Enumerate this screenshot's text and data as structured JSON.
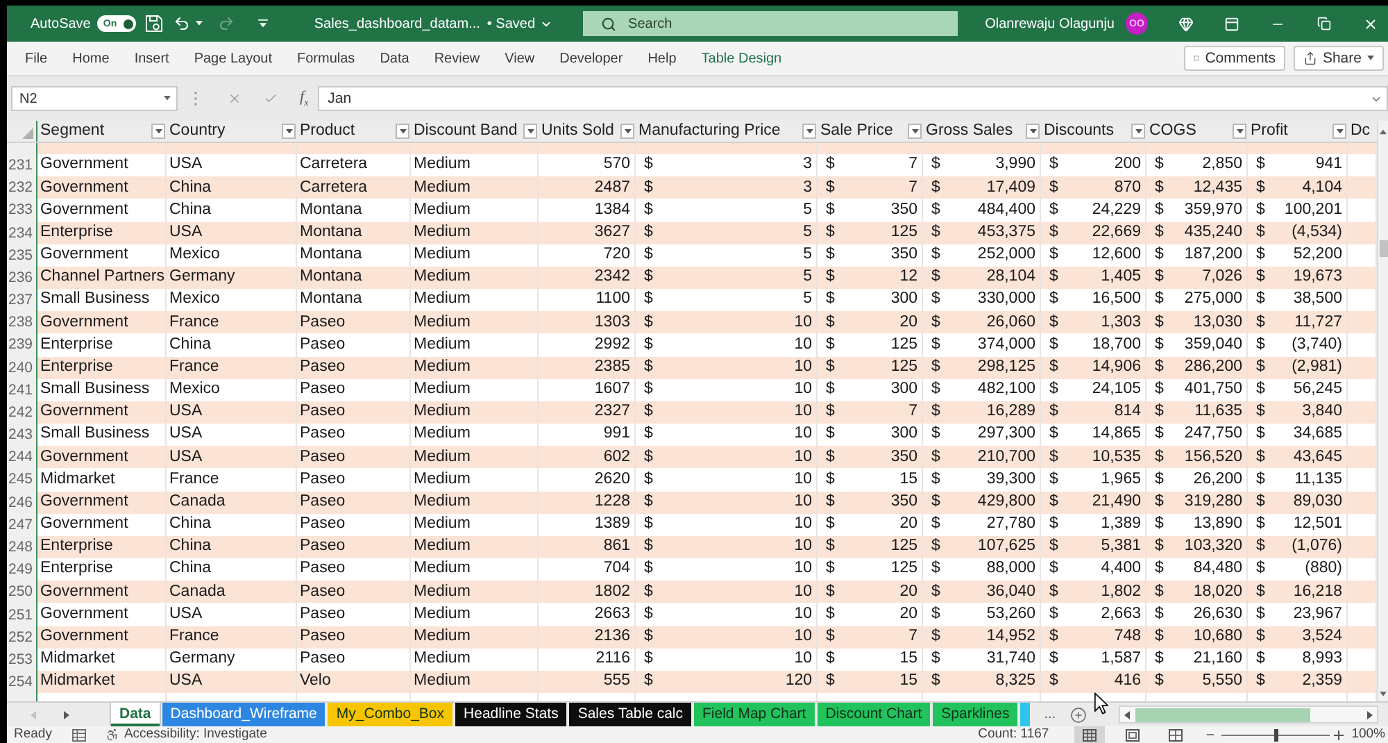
{
  "title_bar": {
    "autosave": {
      "label": "AutoSave",
      "on": true,
      "toggle_text": "On"
    },
    "redo": {
      "disabled": true
    },
    "document_title": "Sales_dashboard_datam...",
    "save_status": "• Saved",
    "search": {
      "placeholder": "Search"
    },
    "user": {
      "name": "Olanrewaju Olagunju",
      "initials": "OO"
    }
  },
  "ribbon": {
    "tabs": [
      {
        "label": "File",
        "kind": "standard",
        "selected": false
      },
      {
        "label": "Home",
        "kind": "standard",
        "selected": false
      },
      {
        "label": "Insert",
        "kind": "standard",
        "selected": false
      },
      {
        "label": "Page Layout",
        "kind": "standard",
        "selected": false
      },
      {
        "label": "Formulas",
        "kind": "standard",
        "selected": false
      },
      {
        "label": "Data",
        "kind": "standard",
        "selected": false
      },
      {
        "label": "Review",
        "kind": "standard",
        "selected": false
      },
      {
        "label": "View",
        "kind": "standard",
        "selected": false
      },
      {
        "label": "Developer",
        "kind": "standard",
        "selected": false
      },
      {
        "label": "Help",
        "kind": "standard",
        "selected": false
      },
      {
        "label": "Table Design",
        "kind": "contextual",
        "selected": false
      }
    ],
    "comments_button": "Comments",
    "share_button": "Share"
  },
  "formula_bar": {
    "name_box": "N2",
    "insert_function": "f$_{x}$",
    "formula": "Jan"
  },
  "table": {
    "columns": [
      {
        "label": "Segment",
        "filter_button": true
      },
      {
        "label": "Country",
        "filter_button": true
      },
      {
        "label": "Product",
        "filter_button": true
      },
      {
        "label": "Discount Band",
        "filter_button": true
      },
      {
        "label": "Units Sold",
        "filter_button": true
      },
      {
        "label": "Manufacturing Price",
        "filter_button": true
      },
      {
        "label": "Sale Price",
        "filter_button": true
      },
      {
        "label": "Gross Sales",
        "filter_button": true
      },
      {
        "label": "Discounts",
        "filter_button": true
      },
      {
        "label": "COGS",
        "filter_button": true
      },
      {
        "label": "Profit",
        "filter_button": true
      },
      {
        "label": "Dc",
        "filter_button": false
      }
    ],
    "rows": [
      {
        "row": "231",
        "cells": [
          "Government",
          "USA",
          "Carretera",
          "Medium",
          "570",
          [
            "$",
            "3"
          ],
          [
            "$",
            "7"
          ],
          [
            "$",
            "3,990"
          ],
          [
            "$",
            "200"
          ],
          [
            "$",
            "2,850"
          ],
          [
            "$",
            "941"
          ]
        ]
      },
      {
        "row": "232",
        "cells": [
          "Government",
          "China",
          "Carretera",
          "Medium",
          "2487",
          [
            "$",
            "3"
          ],
          [
            "$",
            "7"
          ],
          [
            "$",
            "17,409"
          ],
          [
            "$",
            "870"
          ],
          [
            "$",
            "12,435"
          ],
          [
            "$",
            "4,104"
          ]
        ]
      },
      {
        "row": "233",
        "cells": [
          "Government",
          "China",
          "Montana",
          "Medium",
          "1384",
          [
            "$",
            "5"
          ],
          [
            "$",
            "350"
          ],
          [
            "$",
            "484,400"
          ],
          [
            "$",
            "24,229"
          ],
          [
            "$",
            "359,970"
          ],
          [
            "$",
            "100,201"
          ]
        ]
      },
      {
        "row": "234",
        "cells": [
          "Enterprise",
          "USA",
          "Montana",
          "Medium",
          "3627",
          [
            "$",
            "5"
          ],
          [
            "$",
            "125"
          ],
          [
            "$",
            "453,375"
          ],
          [
            "$",
            "22,669"
          ],
          [
            "$",
            "435,240"
          ],
          [
            "$",
            "(4,534)"
          ]
        ]
      },
      {
        "row": "235",
        "cells": [
          "Government",
          "Mexico",
          "Montana",
          "Medium",
          "720",
          [
            "$",
            "5"
          ],
          [
            "$",
            "350"
          ],
          [
            "$",
            "252,000"
          ],
          [
            "$",
            "12,600"
          ],
          [
            "$",
            "187,200"
          ],
          [
            "$",
            "52,200"
          ]
        ]
      },
      {
        "row": "236",
        "cells": [
          "Channel Partners",
          "Germany",
          "Montana",
          "Medium",
          "2342",
          [
            "$",
            "5"
          ],
          [
            "$",
            "12"
          ],
          [
            "$",
            "28,104"
          ],
          [
            "$",
            "1,405"
          ],
          [
            "$",
            "7,026"
          ],
          [
            "$",
            "19,673"
          ]
        ]
      },
      {
        "row": "237",
        "cells": [
          "Small Business",
          "Mexico",
          "Montana",
          "Medium",
          "1100",
          [
            "$",
            "5"
          ],
          [
            "$",
            "300"
          ],
          [
            "$",
            "330,000"
          ],
          [
            "$",
            "16,500"
          ],
          [
            "$",
            "275,000"
          ],
          [
            "$",
            "38,500"
          ]
        ]
      },
      {
        "row": "238",
        "cells": [
          "Government",
          "France",
          "Paseo",
          "Medium",
          "1303",
          [
            "$",
            "10"
          ],
          [
            "$",
            "20"
          ],
          [
            "$",
            "26,060"
          ],
          [
            "$",
            "1,303"
          ],
          [
            "$",
            "13,030"
          ],
          [
            "$",
            "11,727"
          ]
        ]
      },
      {
        "row": "239",
        "cells": [
          "Enterprise",
          "China",
          "Paseo",
          "Medium",
          "2992",
          [
            "$",
            "10"
          ],
          [
            "$",
            "125"
          ],
          [
            "$",
            "374,000"
          ],
          [
            "$",
            "18,700"
          ],
          [
            "$",
            "359,040"
          ],
          [
            "$",
            "(3,740)"
          ]
        ]
      },
      {
        "row": "240",
        "cells": [
          "Enterprise",
          "France",
          "Paseo",
          "Medium",
          "2385",
          [
            "$",
            "10"
          ],
          [
            "$",
            "125"
          ],
          [
            "$",
            "298,125"
          ],
          [
            "$",
            "14,906"
          ],
          [
            "$",
            "286,200"
          ],
          [
            "$",
            "(2,981)"
          ]
        ]
      },
      {
        "row": "241",
        "cells": [
          "Small Business",
          "Mexico",
          "Paseo",
          "Medium",
          "1607",
          [
            "$",
            "10"
          ],
          [
            "$",
            "300"
          ],
          [
            "$",
            "482,100"
          ],
          [
            "$",
            "24,105"
          ],
          [
            "$",
            "401,750"
          ],
          [
            "$",
            "56,245"
          ]
        ]
      },
      {
        "row": "242",
        "cells": [
          "Government",
          "USA",
          "Paseo",
          "Medium",
          "2327",
          [
            "$",
            "10"
          ],
          [
            "$",
            "7"
          ],
          [
            "$",
            "16,289"
          ],
          [
            "$",
            "814"
          ],
          [
            "$",
            "11,635"
          ],
          [
            "$",
            "3,840"
          ]
        ]
      },
      {
        "row": "243",
        "cells": [
          "Small Business",
          "USA",
          "Paseo",
          "Medium",
          "991",
          [
            "$",
            "10"
          ],
          [
            "$",
            "300"
          ],
          [
            "$",
            "297,300"
          ],
          [
            "$",
            "14,865"
          ],
          [
            "$",
            "247,750"
          ],
          [
            "$",
            "34,685"
          ]
        ]
      },
      {
        "row": "244",
        "cells": [
          "Government",
          "USA",
          "Paseo",
          "Medium",
          "602",
          [
            "$",
            "10"
          ],
          [
            "$",
            "350"
          ],
          [
            "$",
            "210,700"
          ],
          [
            "$",
            "10,535"
          ],
          [
            "$",
            "156,520"
          ],
          [
            "$",
            "43,645"
          ]
        ]
      },
      {
        "row": "245",
        "cells": [
          "Midmarket",
          "France",
          "Paseo",
          "Medium",
          "2620",
          [
            "$",
            "10"
          ],
          [
            "$",
            "15"
          ],
          [
            "$",
            "39,300"
          ],
          [
            "$",
            "1,965"
          ],
          [
            "$",
            "26,200"
          ],
          [
            "$",
            "11,135"
          ]
        ]
      },
      {
        "row": "246",
        "cells": [
          "Government",
          "Canada",
          "Paseo",
          "Medium",
          "1228",
          [
            "$",
            "10"
          ],
          [
            "$",
            "350"
          ],
          [
            "$",
            "429,800"
          ],
          [
            "$",
            "21,490"
          ],
          [
            "$",
            "319,280"
          ],
          [
            "$",
            "89,030"
          ]
        ]
      },
      {
        "row": "247",
        "cells": [
          "Government",
          "China",
          "Paseo",
          "Medium",
          "1389",
          [
            "$",
            "10"
          ],
          [
            "$",
            "20"
          ],
          [
            "$",
            "27,780"
          ],
          [
            "$",
            "1,389"
          ],
          [
            "$",
            "13,890"
          ],
          [
            "$",
            "12,501"
          ]
        ]
      },
      {
        "row": "248",
        "cells": [
          "Enterprise",
          "China",
          "Paseo",
          "Medium",
          "861",
          [
            "$",
            "10"
          ],
          [
            "$",
            "125"
          ],
          [
            "$",
            "107,625"
          ],
          [
            "$",
            "5,381"
          ],
          [
            "$",
            "103,320"
          ],
          [
            "$",
            "(1,076)"
          ]
        ]
      },
      {
        "row": "249",
        "cells": [
          "Enterprise",
          "China",
          "Paseo",
          "Medium",
          "704",
          [
            "$",
            "10"
          ],
          [
            "$",
            "125"
          ],
          [
            "$",
            "88,000"
          ],
          [
            "$",
            "4,400"
          ],
          [
            "$",
            "84,480"
          ],
          [
            "$",
            "(880)"
          ]
        ]
      },
      {
        "row": "250",
        "cells": [
          "Government",
          "Canada",
          "Paseo",
          "Medium",
          "1802",
          [
            "$",
            "10"
          ],
          [
            "$",
            "20"
          ],
          [
            "$",
            "36,040"
          ],
          [
            "$",
            "1,802"
          ],
          [
            "$",
            "18,020"
          ],
          [
            "$",
            "16,218"
          ]
        ]
      },
      {
        "row": "251",
        "cells": [
          "Government",
          "USA",
          "Paseo",
          "Medium",
          "2663",
          [
            "$",
            "10"
          ],
          [
            "$",
            "20"
          ],
          [
            "$",
            "53,260"
          ],
          [
            "$",
            "2,663"
          ],
          [
            "$",
            "26,630"
          ],
          [
            "$",
            "23,967"
          ]
        ]
      },
      {
        "row": "252",
        "cells": [
          "Government",
          "France",
          "Paseo",
          "Medium",
          "2136",
          [
            "$",
            "10"
          ],
          [
            "$",
            "7"
          ],
          [
            "$",
            "14,952"
          ],
          [
            "$",
            "748"
          ],
          [
            "$",
            "10,680"
          ],
          [
            "$",
            "3,524"
          ]
        ]
      },
      {
        "row": "253",
        "cells": [
          "Midmarket",
          "Germany",
          "Paseo",
          "Medium",
          "2116",
          [
            "$",
            "10"
          ],
          [
            "$",
            "15"
          ],
          [
            "$",
            "31,740"
          ],
          [
            "$",
            "1,587"
          ],
          [
            "$",
            "21,160"
          ],
          [
            "$",
            "8,993"
          ]
        ]
      },
      {
        "row": "254",
        "cells": [
          "Midmarket",
          "USA",
          "Velo",
          "Medium",
          "555",
          [
            "$",
            "120"
          ],
          [
            "$",
            "15"
          ],
          [
            "$",
            "8,325"
          ],
          [
            "$",
            "416"
          ],
          [
            "$",
            "5,550"
          ],
          [
            "$",
            "2,359"
          ]
        ]
      }
    ]
  },
  "sheet_tabs": [
    {
      "label": "Data",
      "kind": "full",
      "selected": true
    },
    {
      "label": "Dashboard_Wireframe",
      "kind": "full",
      "color": "#2d87e2",
      "selected": false
    },
    {
      "label": "My_Combo_Box",
      "kind": "full",
      "color": "#f6c500",
      "selected": false
    },
    {
      "label": "Headline Stats",
      "kind": "full",
      "color": "#0d0d0d",
      "selected": false
    },
    {
      "label": "Sales Table calc",
      "kind": "full",
      "color": "#0d0d0d",
      "selected": false
    },
    {
      "label": "Field Map Chart",
      "kind": "full",
      "color": "#22c25c",
      "selected": false
    },
    {
      "label": "Discount Chart",
      "kind": "full",
      "color": "#22c25c",
      "selected": false
    },
    {
      "label": "Sparklines",
      "kind": "full",
      "color": "#22c25c",
      "selected": false
    },
    {
      "kind": "clipped",
      "color": "#2fc4ec",
      "selected": false
    }
  ],
  "more_sheets": "...",
  "status_bar": {
    "mode": "Ready",
    "accessibility": "Accessibility: Investigate",
    "count": "Count: 1167",
    "views": [
      {
        "kind": "normal",
        "selected": true
      },
      {
        "kind": "page_layout",
        "selected": false
      },
      {
        "kind": "page_break_preview",
        "selected": false
      }
    ],
    "zoom": {
      "level": 0.5,
      "reading": "100%"
    }
  }
}
